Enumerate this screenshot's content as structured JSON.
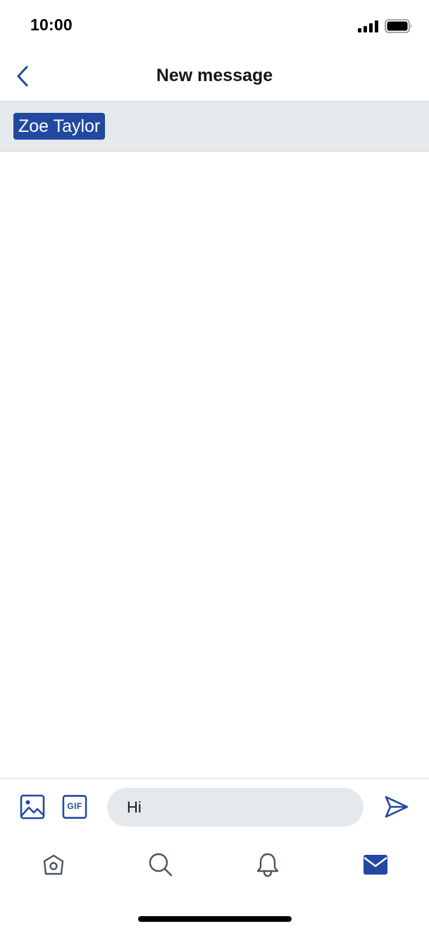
{
  "status_bar": {
    "time": "10:00"
  },
  "header": {
    "title": "New message",
    "back_icon": "chevron-left-icon"
  },
  "recipients": [
    {
      "name": "Zoe Taylor"
    }
  ],
  "composer": {
    "input_value": "Hi",
    "image_icon": "image-icon",
    "gif_label": "GIF",
    "send_icon": "send-icon"
  },
  "tabs": [
    {
      "name": "home",
      "icon": "home-icon",
      "active": false
    },
    {
      "name": "search",
      "icon": "search-icon",
      "active": false
    },
    {
      "name": "notifications",
      "icon": "bell-icon",
      "active": false
    },
    {
      "name": "messages",
      "icon": "envelope-icon",
      "active": true
    }
  ],
  "colors": {
    "accent": "#2248a0",
    "icon_inactive": "#4a5560",
    "recipient_bar_bg": "#e6e9ec",
    "input_bg": "#e6e9ec"
  }
}
